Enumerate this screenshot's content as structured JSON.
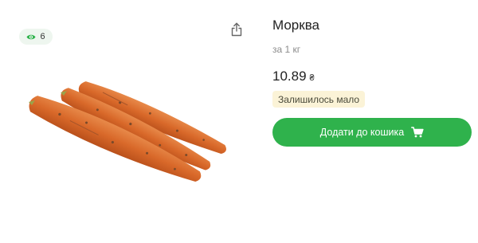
{
  "views": {
    "icon": "eye-icon",
    "count": "6"
  },
  "share": {
    "icon": "share-icon"
  },
  "product": {
    "image": "carrots-image",
    "title": "Морква",
    "unit": "за 1 кг",
    "price": "10.89",
    "currency": "₴",
    "stock_status": "Залишилось мало"
  },
  "cart_button": {
    "label": "Додати до кошика",
    "icon": "cart-icon"
  },
  "colors": {
    "accent": "#2fb24c",
    "stock_badge_bg": "#fbf3d7",
    "views_badge_bg": "#eef6ef",
    "carrot": "#d9692a"
  }
}
